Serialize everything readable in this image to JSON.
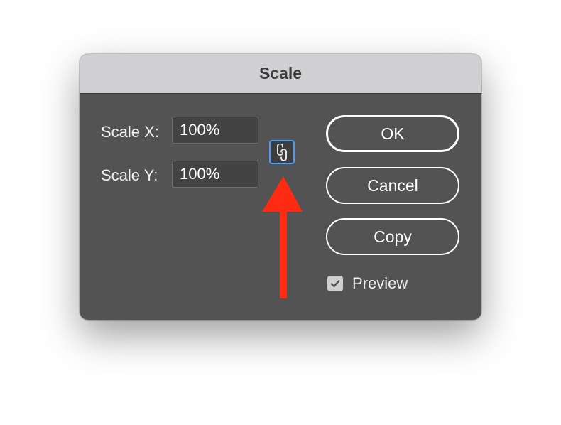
{
  "dialog": {
    "title": "Scale",
    "scale_x": {
      "label": "Scale X:",
      "value": "100%"
    },
    "scale_y": {
      "label": "Scale Y:",
      "value": "100%"
    },
    "constrain_icon": "link-icon",
    "buttons": {
      "ok": "OK",
      "cancel": "Cancel",
      "copy": "Copy"
    },
    "preview": {
      "label": "Preview",
      "checked": true
    }
  },
  "annotation": {
    "icon": "red-arrow-icon",
    "color": "#ff2a12"
  },
  "colors": {
    "dialog_bg": "#535353",
    "titlebar_bg": "#d0d0d2",
    "focus_ring": "#4a9bff"
  }
}
